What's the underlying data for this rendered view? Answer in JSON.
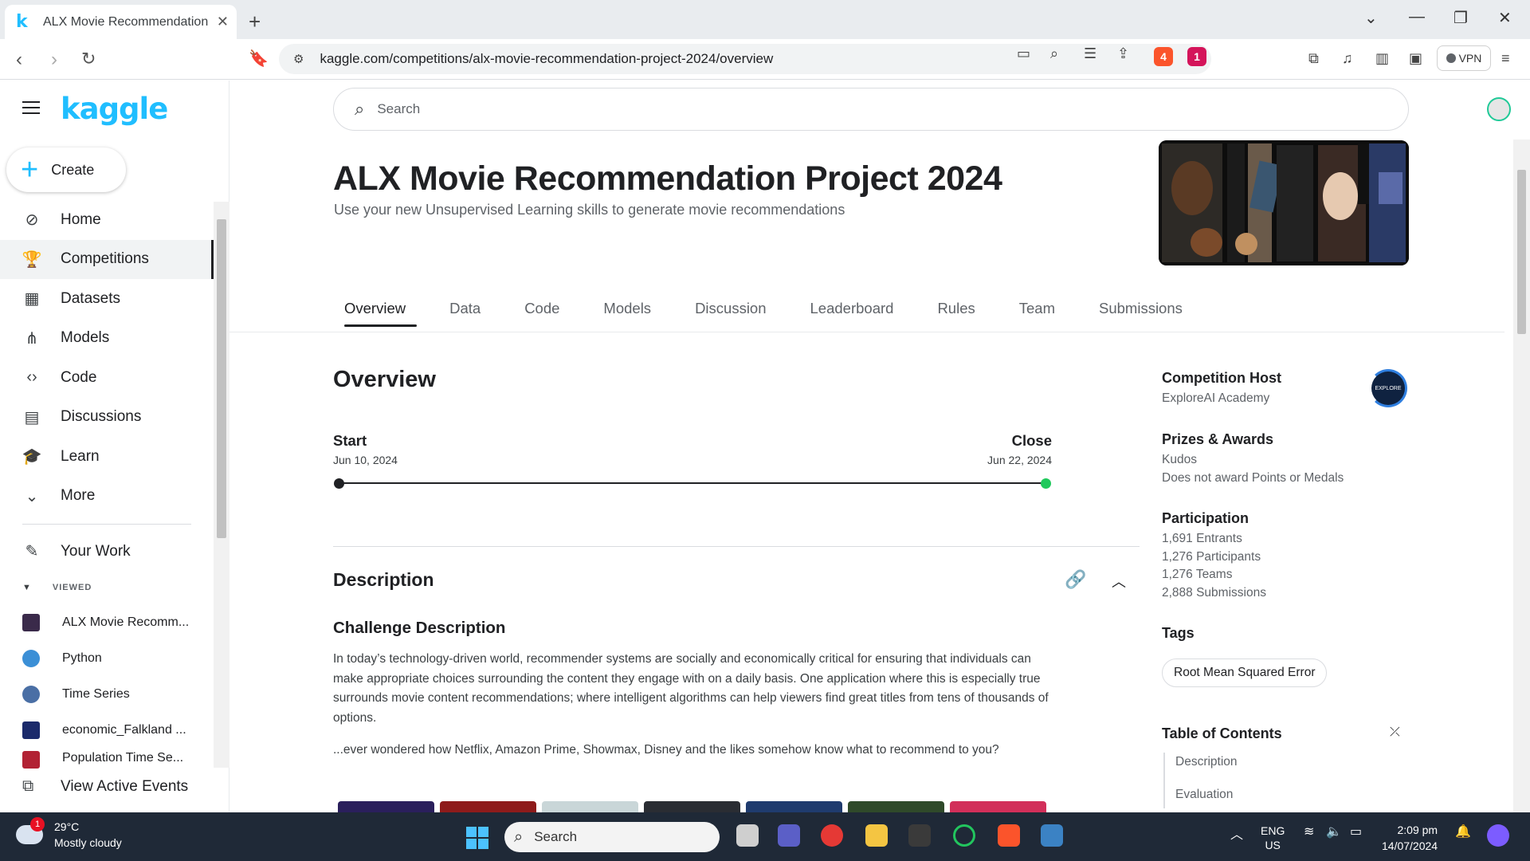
{
  "browser": {
    "tab_title": "ALX Movie Recommendation Pr",
    "tab_favicon": "k",
    "url": "kaggle.com/competitions/alx-movie-recommendation-project-2024/overview",
    "brave_badge": "4",
    "rewards_badge": "1",
    "vpn_label": "VPN"
  },
  "sidebar": {
    "logo": "kaggle",
    "create_label": "Create",
    "nav": [
      {
        "label": "Home",
        "icon": "compass-icon"
      },
      {
        "label": "Competitions",
        "icon": "trophy-icon"
      },
      {
        "label": "Datasets",
        "icon": "table-icon"
      },
      {
        "label": "Models",
        "icon": "models-icon"
      },
      {
        "label": "Code",
        "icon": "code-icon"
      },
      {
        "label": "Discussions",
        "icon": "comments-icon"
      },
      {
        "label": "Learn",
        "icon": "school-icon"
      },
      {
        "label": "More",
        "icon": "chevron-down-icon"
      }
    ],
    "your_work": "Your Work",
    "viewed_heading": "VIEWED",
    "viewed": [
      {
        "label": "ALX Movie Recomm...",
        "color": "#3a2a4a"
      },
      {
        "label": "Python",
        "color": "#3b8fd6"
      },
      {
        "label": "Time Series",
        "color": "#4a6fa5"
      },
      {
        "label": "economic_Falkland ...",
        "color": "#1b2a6b"
      },
      {
        "label": "Population Time Se...",
        "color": "#b22234"
      }
    ],
    "active_events": "View Active Events"
  },
  "main": {
    "search_placeholder": "Search",
    "title": "ALX Movie Recommendation Project 2024",
    "subtitle": "Use your new Unsupervised Learning skills to generate movie recommendations",
    "tabs": [
      "Overview",
      "Data",
      "Code",
      "Models",
      "Discussion",
      "Leaderboard",
      "Rules",
      "Team",
      "Submissions"
    ],
    "active_tab": "Overview",
    "overview_heading": "Overview",
    "timeline": {
      "start_label": "Start",
      "start_date": "Jun 10, 2024",
      "close_label": "Close",
      "close_date": "Jun 22, 2024",
      "progress": 1.0
    },
    "description_heading": "Description",
    "challenge_heading": "Challenge Description",
    "challenge_text": "In today’s technology-driven world, recommender systems are socially and economically critical for ensuring that individuals can make appropriate choices surrounding the content they engage with on a daily basis. One application where this is especially true surrounds movie content recommendations; where intelligent algorithms can help viewers find great titles from tens of thousands of options.",
    "challenge_question": "...ever wondered how Netflix, Amazon Prime, Showmax, Disney and the likes somehow know what to recommend to you?",
    "poster_colors": [
      "#2a1f5c",
      "#8e1b1b",
      "#c9d6d8",
      "#2a2d33",
      "#1f3b6e",
      "#2f4a2a",
      "#d22f5a"
    ]
  },
  "right_panel": {
    "host_heading": "Competition Host",
    "host_name": "ExploreAI Academy",
    "prizes_heading": "Prizes & Awards",
    "prizes": [
      "Kudos",
      "Does not award Points or Medals"
    ],
    "participation_heading": "Participation",
    "participation": [
      "1,691 Entrants",
      "1,276 Participants",
      "1,276 Teams",
      "2,888 Submissions"
    ],
    "tags_heading": "Tags",
    "tags": [
      "Root Mean Squared Error"
    ],
    "toc_heading": "Table of Contents",
    "toc": [
      "Description",
      "Evaluation"
    ]
  },
  "taskbar": {
    "temperature": "29°C",
    "weather": "Mostly cloudy",
    "weather_badge": "1",
    "search_label": "Search",
    "lang_top": "ENG",
    "lang_bottom": "US",
    "time": "2:09 pm",
    "date": "14/07/2024"
  }
}
